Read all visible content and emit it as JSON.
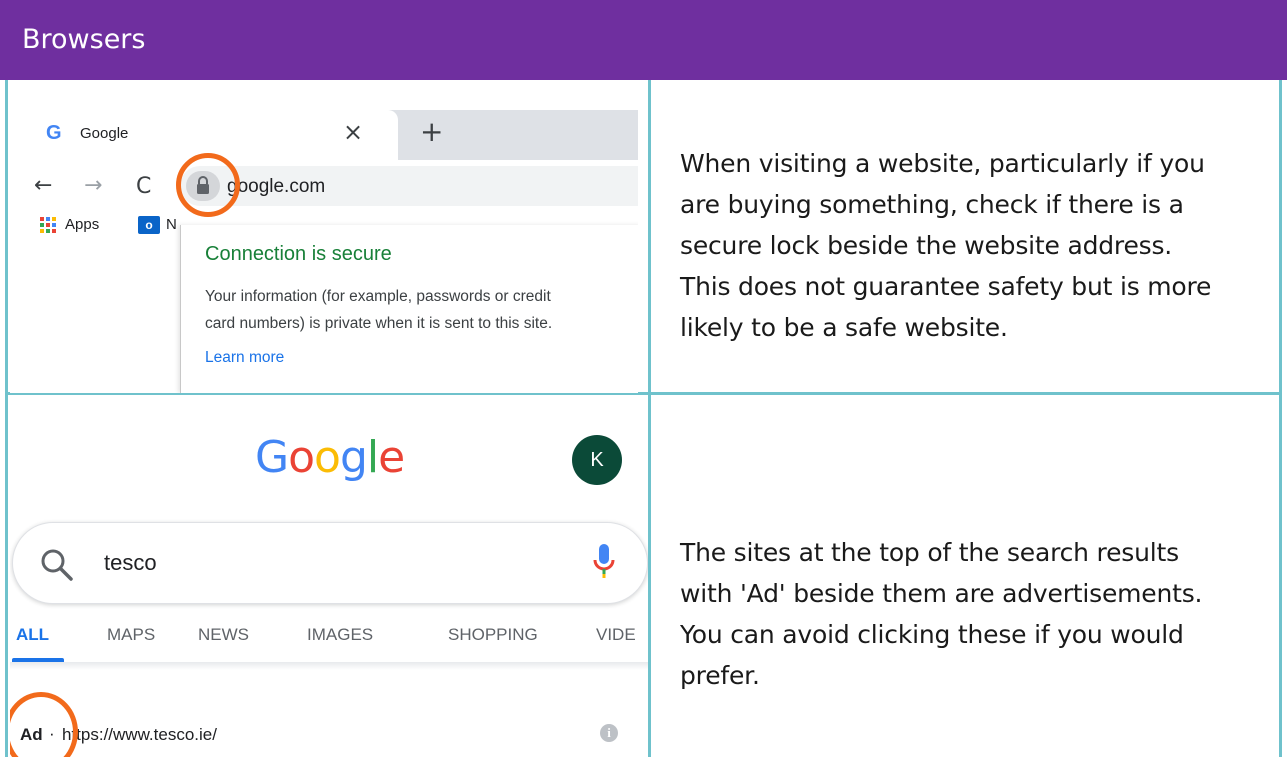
{
  "header": {
    "title": "Browsers"
  },
  "rows": [
    {
      "description_lines": [
        "When visiting a website, particularly if you",
        "are buying something, check if there is a",
        "secure lock beside the website address.",
        "This does not guarantee safety but is more",
        "likely to be a safe website."
      ]
    },
    {
      "description_lines": [
        "The sites at the top of the search results",
        "with 'Ad' beside them are advertisements.",
        "You can avoid clicking these if you would",
        "prefer."
      ]
    }
  ],
  "browser": {
    "tab_title": "Google",
    "tab_icon_letter": "G",
    "close_glyph": "×",
    "new_tab_glyph": "+",
    "back_glyph": "←",
    "forward_glyph": "→",
    "reload_glyph": "C",
    "url": "google.com",
    "bookmarks": {
      "apps_label": "Apps",
      "outlook_letter": "o",
      "truncated": "N"
    },
    "popup": {
      "title": "Connection is secure",
      "body_lines": [
        "Your information (for example, passwords or credit",
        "card numbers) is private when it is sent to this site."
      ],
      "link": "Learn more"
    },
    "highlight_color": "#f26a1b"
  },
  "search": {
    "logo_letters": [
      {
        "ch": "G",
        "color": "#4285f4"
      },
      {
        "ch": "o",
        "color": "#ea4335"
      },
      {
        "ch": "o",
        "color": "#fbbc05"
      },
      {
        "ch": "g",
        "color": "#4285f4"
      },
      {
        "ch": "l",
        "color": "#34a853"
      },
      {
        "ch": "e",
        "color": "#ea4335"
      }
    ],
    "avatar_letter": "K",
    "query": "tesco",
    "tabs": [
      "ALL",
      "MAPS",
      "NEWS",
      "IMAGES",
      "SHOPPING",
      "VIDE"
    ],
    "active_tab": "ALL",
    "result": {
      "ad_label": "Ad",
      "separator": "·",
      "url": "https://www.tesco.ie/"
    }
  },
  "colors": {
    "header": "#6f2f9f",
    "grid": "#6fc2cc",
    "accent_circle": "#f26a1b"
  }
}
